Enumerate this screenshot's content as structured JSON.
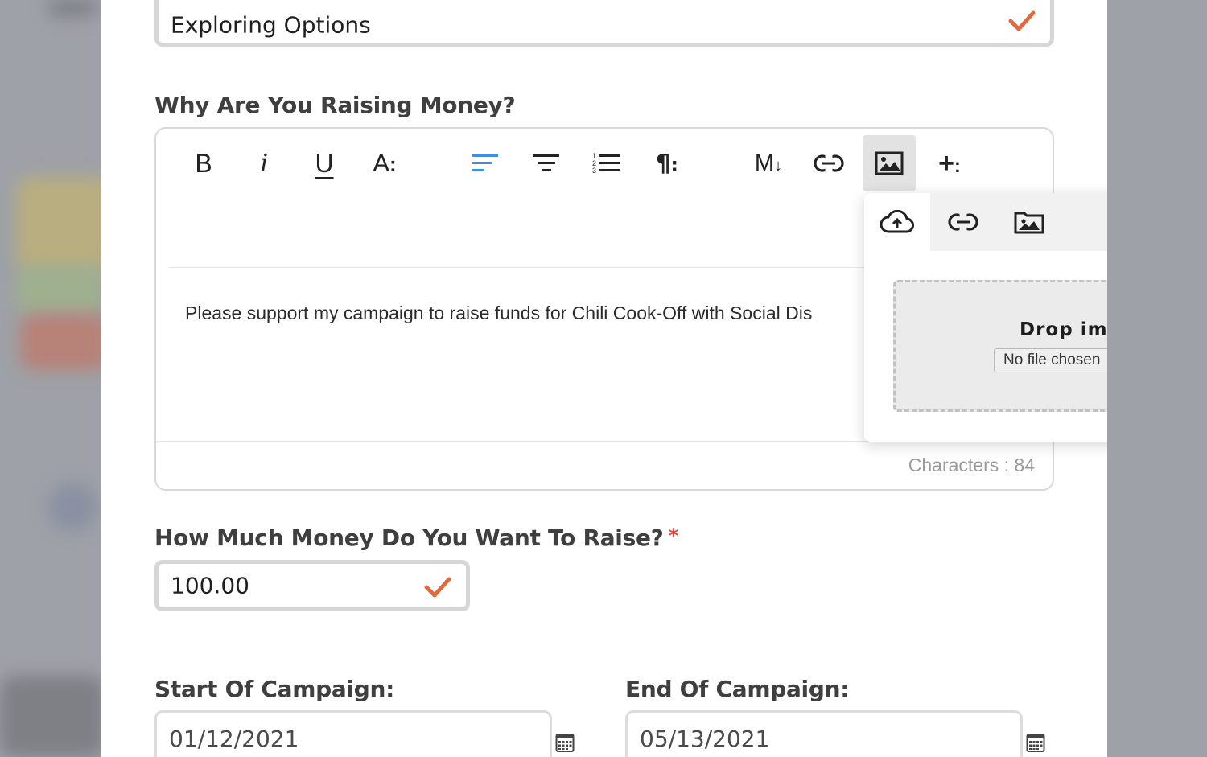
{
  "colors": {
    "accent": "#e06a3c",
    "active_align": "#3d8ee8",
    "required": "#e0463f"
  },
  "status_field": {
    "value": "Exploring Options"
  },
  "why_section": {
    "label": "Why Are You Raising Money?"
  },
  "editor": {
    "toolbar": [
      {
        "name": "bold-icon",
        "glyph": "B"
      },
      {
        "name": "italic-icon",
        "glyph": "i"
      },
      {
        "name": "underline-icon",
        "glyph": "U"
      },
      {
        "name": "font-size-icon",
        "glyph": "A⁝"
      },
      {
        "name": "align-left-icon",
        "glyph": "align-left"
      },
      {
        "name": "align-center-icon",
        "glyph": "align-center"
      },
      {
        "name": "ordered-list-icon",
        "glyph": "ordered-list"
      },
      {
        "name": "paragraph-icon",
        "glyph": "¶⁝"
      },
      {
        "name": "markdown-icon",
        "glyph": "M↓"
      },
      {
        "name": "link-icon",
        "glyph": "link"
      },
      {
        "name": "image-icon",
        "glyph": "image"
      },
      {
        "name": "more-icon",
        "glyph": "+⁝"
      }
    ],
    "content": "Please support my campaign to raise funds for Chili Cook-Off with Social Dis",
    "char_count": "Characters : 84"
  },
  "image_popup": {
    "tabs": [
      "upload-icon",
      "link-icon",
      "image-icon"
    ],
    "drop_title": "Drop ima",
    "file_button": "No file chosen"
  },
  "amount": {
    "label": "How Much Money Do You Want To Raise?",
    "required": "*",
    "value": "100.00"
  },
  "start": {
    "label": "Start Of Campaign:",
    "value": "01/12/2021"
  },
  "end": {
    "label": "End Of Campaign:",
    "value": "05/13/2021"
  }
}
